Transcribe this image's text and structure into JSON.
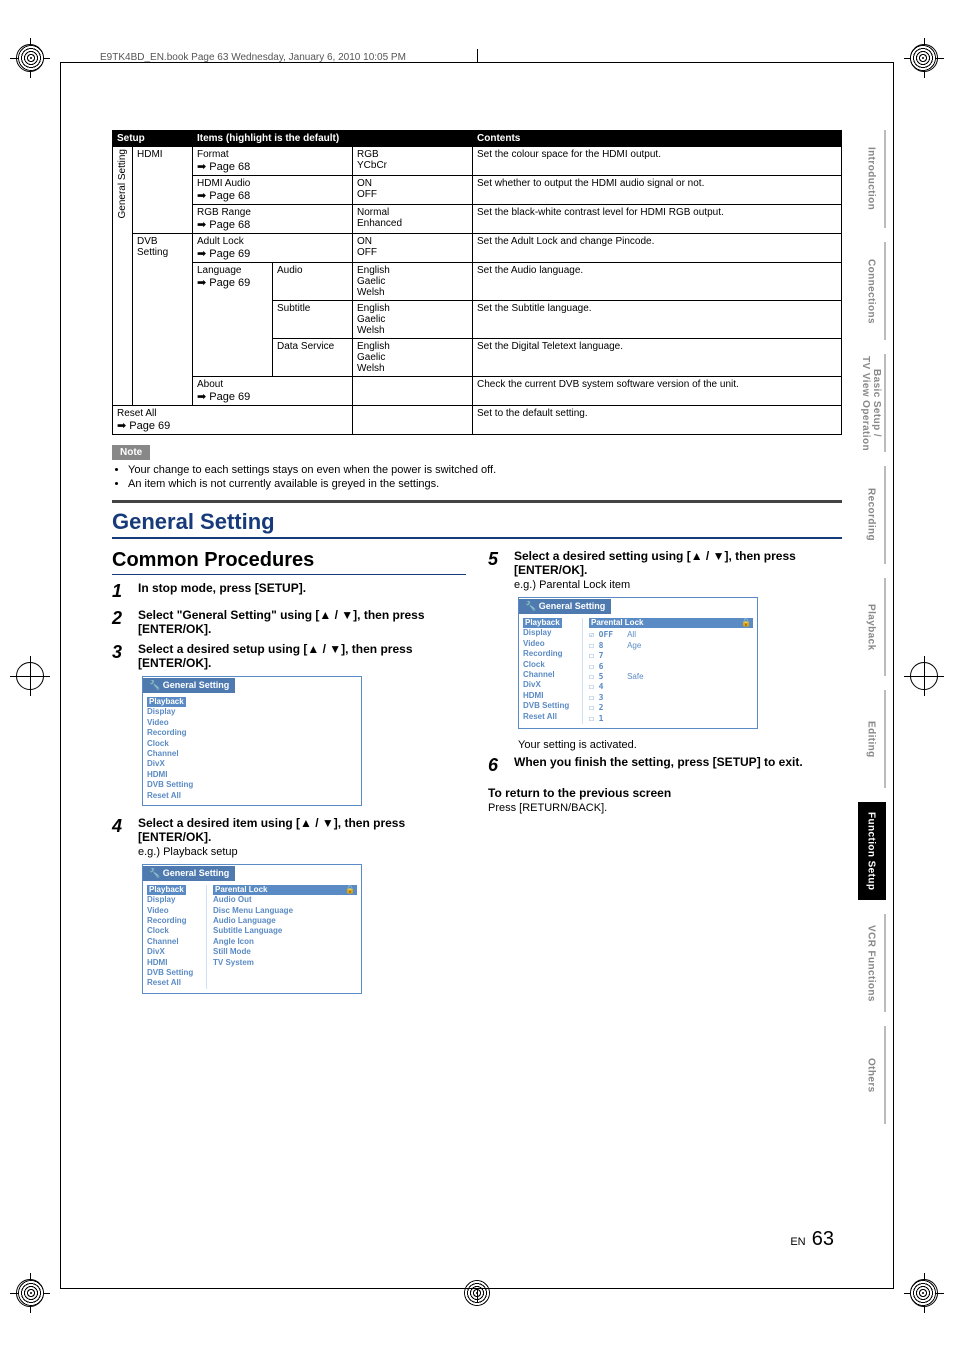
{
  "header_line": "E9TK4BD_EN.book  Page 63  Wednesday, January 6, 2010  10:05 PM",
  "table": {
    "headers": [
      "Setup",
      "Items (highlight is the default)",
      "Contents"
    ],
    "vertical_label": "General Setting",
    "rows": [
      {
        "setup": "HDMI",
        "item": "Format",
        "pageref": "➡ Page 68",
        "sub": "",
        "opts": "RGB\nYCbCr",
        "desc": "Set the colour space for the HDMI output."
      },
      {
        "setup": "",
        "item": "HDMI Audio",
        "pageref": "➡ Page 68",
        "sub": "",
        "opts": "ON\nOFF",
        "desc": "Set whether to output the HDMI audio signal or not."
      },
      {
        "setup": "",
        "item": "RGB Range",
        "pageref": "➡ Page 68",
        "sub": "",
        "opts": "Normal\nEnhanced",
        "desc": "Set the black-white contrast level for HDMI RGB output."
      },
      {
        "setup": "DVB Setting",
        "item": "Adult Lock",
        "pageref": "➡ Page 69",
        "sub": "",
        "opts": "ON\nOFF",
        "desc": "Set the Adult Lock and change Pincode."
      },
      {
        "setup": "",
        "item": "Language",
        "pageref": "➡ Page 69",
        "sub": "Audio",
        "opts": "English\nGaelic\nWelsh",
        "desc": "Set the Audio language."
      },
      {
        "setup": "",
        "item": "",
        "pageref": "",
        "sub": "Subtitle",
        "opts": "English\nGaelic\nWelsh",
        "desc": "Set the Subtitle language."
      },
      {
        "setup": "",
        "item": "",
        "pageref": "",
        "sub": "Data Service",
        "opts": "English\nGaelic\nWelsh",
        "desc": "Set the Digital Teletext language."
      },
      {
        "setup": "",
        "item": "About",
        "pageref": "➡ Page 69",
        "sub": "",
        "opts": "",
        "desc": "Check the current DVB system software version of the unit."
      },
      {
        "setup": "Reset All",
        "item": "",
        "pageref": "➡ Page 69",
        "sub": "",
        "opts": "",
        "desc": "Set to the default setting."
      }
    ]
  },
  "note_label": "Note",
  "notes": [
    "Your change to each settings stays on even when the power is switched off.",
    "An item which is not currently available is greyed in the settings."
  ],
  "section_title": "General Setting",
  "sub_heading": "Common Procedures",
  "steps": {
    "s1": "In stop mode, press [SETUP].",
    "s2": "Select \"General Setting\" using [▲ / ▼], then press [ENTER/OK].",
    "s3": "Select a desired setup using [▲ / ▼], then press [ENTER/OK].",
    "s4": "Select a desired item using [▲ / ▼], then press [ENTER/OK].",
    "s4_sub": "e.g.) Playback setup",
    "s5": "Select a desired setting using [▲ / ▼], then press [ENTER/OK].",
    "s5_sub": "e.g.) Parental Lock item",
    "s5_note": "Your setting is activated.",
    "s6": "When you finish the setting, press [SETUP] to exit."
  },
  "return": {
    "head": "To return to the previous screen",
    "body": "Press [RETURN/BACK]."
  },
  "ui": {
    "title": "General Setting",
    "left_items": [
      "Playback",
      "Display",
      "Video",
      "Recording",
      "Clock",
      "Channel",
      "DivX",
      "HDMI",
      "DVB Setting",
      "Reset All"
    ],
    "playback_panel": [
      "Parental Lock",
      "Audio Out",
      "Disc Menu Language",
      "Audio Language",
      "Subtitle Language",
      "Angle Icon",
      "Still Mode",
      "TV System"
    ],
    "parental_opts": [
      "OFF",
      "8",
      "7",
      "6",
      "5",
      "4",
      "3",
      "2",
      "1"
    ],
    "parental_tags": [
      "All",
      "Age",
      "",
      "",
      "Safe"
    ]
  },
  "tabs": [
    "Introduction",
    "Connections",
    "Basic Setup /\nTV View Operation",
    "Recording",
    "Playback",
    "Editing",
    "Function Setup",
    "VCR Functions",
    "Others"
  ],
  "active_tab_index": 6,
  "page": {
    "lang": "EN",
    "num": "63"
  }
}
